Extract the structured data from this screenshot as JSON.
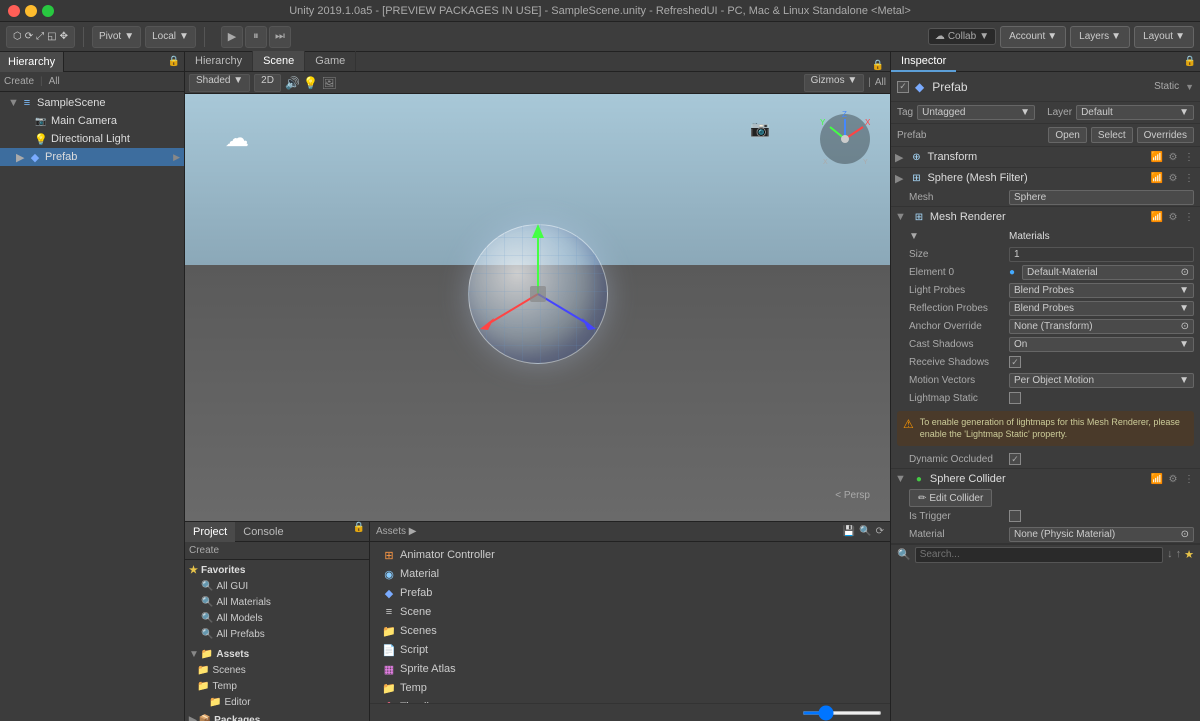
{
  "titleBar": {
    "title": "Unity 2019.1.0a5 - [PREVIEW PACKAGES IN USE] - SampleScene.unity - RefreshedUI - PC, Mac & Linux Standalone <Metal>"
  },
  "toolbar": {
    "pivot": "Pivot",
    "local": "Local",
    "collab": "Collab",
    "account": "Account",
    "layers": "Layers",
    "layout": "Layout",
    "playBtn": "▶",
    "pauseBtn": "⏸",
    "stepBtn": "⏭"
  },
  "hierarchy": {
    "tab": "Hierarchy",
    "create": "Create",
    "all": "All",
    "items": [
      {
        "name": "SampleScene",
        "level": 0,
        "arrow": "▼",
        "icon": "scene"
      },
      {
        "name": "Main Camera",
        "level": 1,
        "arrow": "",
        "icon": "camera"
      },
      {
        "name": "Directional Light",
        "level": 1,
        "arrow": "",
        "icon": "light"
      },
      {
        "name": "Prefab",
        "level": 1,
        "arrow": "▶",
        "icon": "prefab",
        "selected": true
      }
    ]
  },
  "sceneView": {
    "tabs": [
      {
        "label": "Hierarchy",
        "active": false
      },
      {
        "label": "Scene",
        "active": true
      },
      {
        "label": "Game",
        "active": false
      }
    ],
    "toolbar": {
      "shaded": "Shaded",
      "twoD": "2D",
      "gizmos": "Gizmos",
      "all": "All"
    },
    "perspLabel": "< Persp"
  },
  "inspector": {
    "tab": "Inspector",
    "prefabName": "Prefab",
    "staticLabel": "Static",
    "tag": "Untagged",
    "layer": "Default",
    "prefabBtn": {
      "open": "Open",
      "select": "Select",
      "overrides": "Overrides"
    },
    "transform": {
      "title": "Transform"
    },
    "meshFilter": {
      "title": "Sphere (Mesh Filter)",
      "meshLabel": "Mesh",
      "meshValue": "Sphere"
    },
    "meshRenderer": {
      "title": "Mesh Renderer",
      "materialsLabel": "Materials",
      "sizeLabel": "Size",
      "sizeValue": "1",
      "element0Label": "Element 0",
      "element0Value": "Default-Material",
      "lightProbesLabel": "Light Probes",
      "lightProbesValue": "Blend Probes",
      "reflectionProbesLabel": "Reflection Probes",
      "reflectionProbesValue": "Blend Probes",
      "anchorOverrideLabel": "Anchor Override",
      "anchorOverrideValue": "None (Transform)",
      "castShadowsLabel": "Cast Shadows",
      "castShadowsValue": "On",
      "receiveShadowsLabel": "Receive Shadows",
      "receiveShadowsChecked": true,
      "motionVectorsLabel": "Motion Vectors",
      "motionVectorsValue": "Per Object Motion",
      "lightmapStaticLabel": "Lightmap Static",
      "warningText": "To enable generation of lightmaps for this Mesh Renderer, please enable the 'Lightmap Static' property.",
      "dynamicOccludedLabel": "Dynamic Occluded",
      "dynamicOccludedChecked": true
    },
    "sphereCollider": {
      "title": "Sphere Collider",
      "editBtnLabel": "Edit Collider",
      "isTriggerLabel": "Is Trigger",
      "materialLabel": "Material",
      "materialValue": "None (Physic Material)"
    }
  },
  "bottomPanel": {
    "projectTab": "Project",
    "consoleTab": "Console",
    "createLabel": "Create",
    "favorites": {
      "title": "Favorites",
      "items": [
        "All GUI",
        "All Materials",
        "All Models",
        "All Prefabs"
      ]
    },
    "assets": {
      "title": "Assets",
      "treeItems": [
        "Scenes",
        "Temp",
        "Editor"
      ]
    },
    "packages": "Packages",
    "assetsHeader": "Assets",
    "assetList": [
      {
        "name": "Animator Controller",
        "icon": "controller"
      },
      {
        "name": "Material",
        "icon": "material"
      },
      {
        "name": "Prefab",
        "icon": "prefab"
      },
      {
        "name": "Scene",
        "icon": "scene"
      },
      {
        "name": "Scenes",
        "icon": "folder"
      },
      {
        "name": "Script",
        "icon": "script"
      },
      {
        "name": "Sprite Atlas",
        "icon": "atlas"
      },
      {
        "name": "Temp",
        "icon": "folder"
      },
      {
        "name": "Timeline",
        "icon": "timeline"
      }
    ]
  }
}
